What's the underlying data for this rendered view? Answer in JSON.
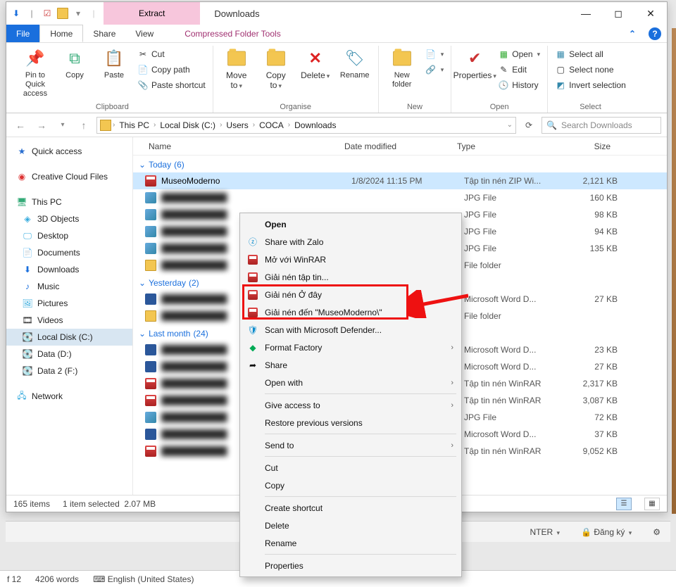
{
  "title": {
    "context_tab": "Extract",
    "window": "Downloads"
  },
  "tabs": {
    "file": "File",
    "home": "Home",
    "share": "Share",
    "view": "View",
    "compressed": "Compressed Folder Tools"
  },
  "ribbon": {
    "clipboard": {
      "label": "Clipboard",
      "pin": "Pin to Quick\naccess",
      "copy": "Copy",
      "paste": "Paste",
      "cut": "Cut",
      "copypath": "Copy path",
      "pasteshortcut": "Paste shortcut"
    },
    "organise": {
      "label": "Organise",
      "moveto": "Move\nto",
      "copyto": "Copy\nto",
      "delete": "Delete",
      "rename": "Rename"
    },
    "new": {
      "label": "New",
      "newfolder": "New\nfolder"
    },
    "open": {
      "label": "Open",
      "properties": "Properties",
      "open": "Open",
      "edit": "Edit",
      "history": "History"
    },
    "select": {
      "label": "Select",
      "selectall": "Select all",
      "selectnone": "Select none",
      "invert": "Invert selection"
    }
  },
  "breadcrumbs": [
    "This PC",
    "Local Disk (C:)",
    "Users",
    "COCA",
    "Downloads"
  ],
  "search_placeholder": "Search Downloads",
  "columns": {
    "name": "Name",
    "date": "Date modified",
    "type": "Type",
    "size": "Size"
  },
  "groups": {
    "today": {
      "label": "Today",
      "count": "(6)"
    },
    "yesterday": {
      "label": "Yesterday",
      "count": "(2)"
    },
    "lastmonth": {
      "label": "Last month",
      "count": "(24)"
    }
  },
  "selrow": {
    "name": "MuseoModerno",
    "date": "1/8/2024 11:15 PM",
    "type": "Tập tin nén ZIP Wi...",
    "size": "2,121 KB"
  },
  "rows_today": [
    {
      "type": "JPG File",
      "size": "160 KB"
    },
    {
      "type": "JPG File",
      "size": "98 KB"
    },
    {
      "type": "JPG File",
      "size": "94 KB"
    },
    {
      "type": "JPG File",
      "size": "135 KB"
    },
    {
      "type": "File folder",
      "size": ""
    }
  ],
  "rows_yesterday": [
    {
      "type": "Microsoft Word D...",
      "size": "27 KB"
    },
    {
      "type": "File folder",
      "size": ""
    }
  ],
  "rows_lastmonth": [
    {
      "type": "Microsoft Word D...",
      "size": "23 KB"
    },
    {
      "type": "Microsoft Word D...",
      "size": "27 KB"
    },
    {
      "type": "Tập tin nén WinRAR",
      "size": "2,317 KB"
    },
    {
      "type": "Tập tin nén WinRAR",
      "size": "3,087 KB"
    },
    {
      "type": "JPG File",
      "size": "72 KB"
    },
    {
      "type": "Microsoft Word D...",
      "size": "37 KB"
    },
    {
      "type": "Tập tin nén WinRAR",
      "size": "9,052 KB"
    }
  ],
  "sidebar": {
    "quick": "Quick access",
    "creative": "Creative Cloud Files",
    "thispc": "This PC",
    "items": [
      "3D Objects",
      "Desktop",
      "Documents",
      "Downloads",
      "Music",
      "Pictures",
      "Videos",
      "Local Disk (C:)",
      "Data (D:)",
      "Data 2 (F:)"
    ],
    "network": "Network"
  },
  "status": {
    "items": "165 items",
    "selected": "1 item selected",
    "size": "2.07 MB"
  },
  "ctx": {
    "open": "Open",
    "zalo": "Share with Zalo",
    "openrar": "Mở với WinRAR",
    "extractto": "Giải nén tập tin...",
    "extracthere": "Giải nén Ở đây",
    "extractfolder": "Giải nén đến \"MuseoModerno\\\"",
    "defender": "Scan with Microsoft Defender...",
    "format": "Format Factory",
    "share": "Share",
    "openwith": "Open with",
    "giveaccess": "Give access to",
    "restore": "Restore previous versions",
    "sendto": "Send to",
    "cut": "Cut",
    "copy": "Copy",
    "createshortcut": "Create shortcut",
    "delete": "Delete",
    "rename": "Rename",
    "properties": "Properties"
  },
  "bg2": {
    "enter": "NTER",
    "dangky": "Đăng ký"
  },
  "bg3": {
    "page": "f 12",
    "words": "4206 words",
    "lang": "English (United States)"
  }
}
